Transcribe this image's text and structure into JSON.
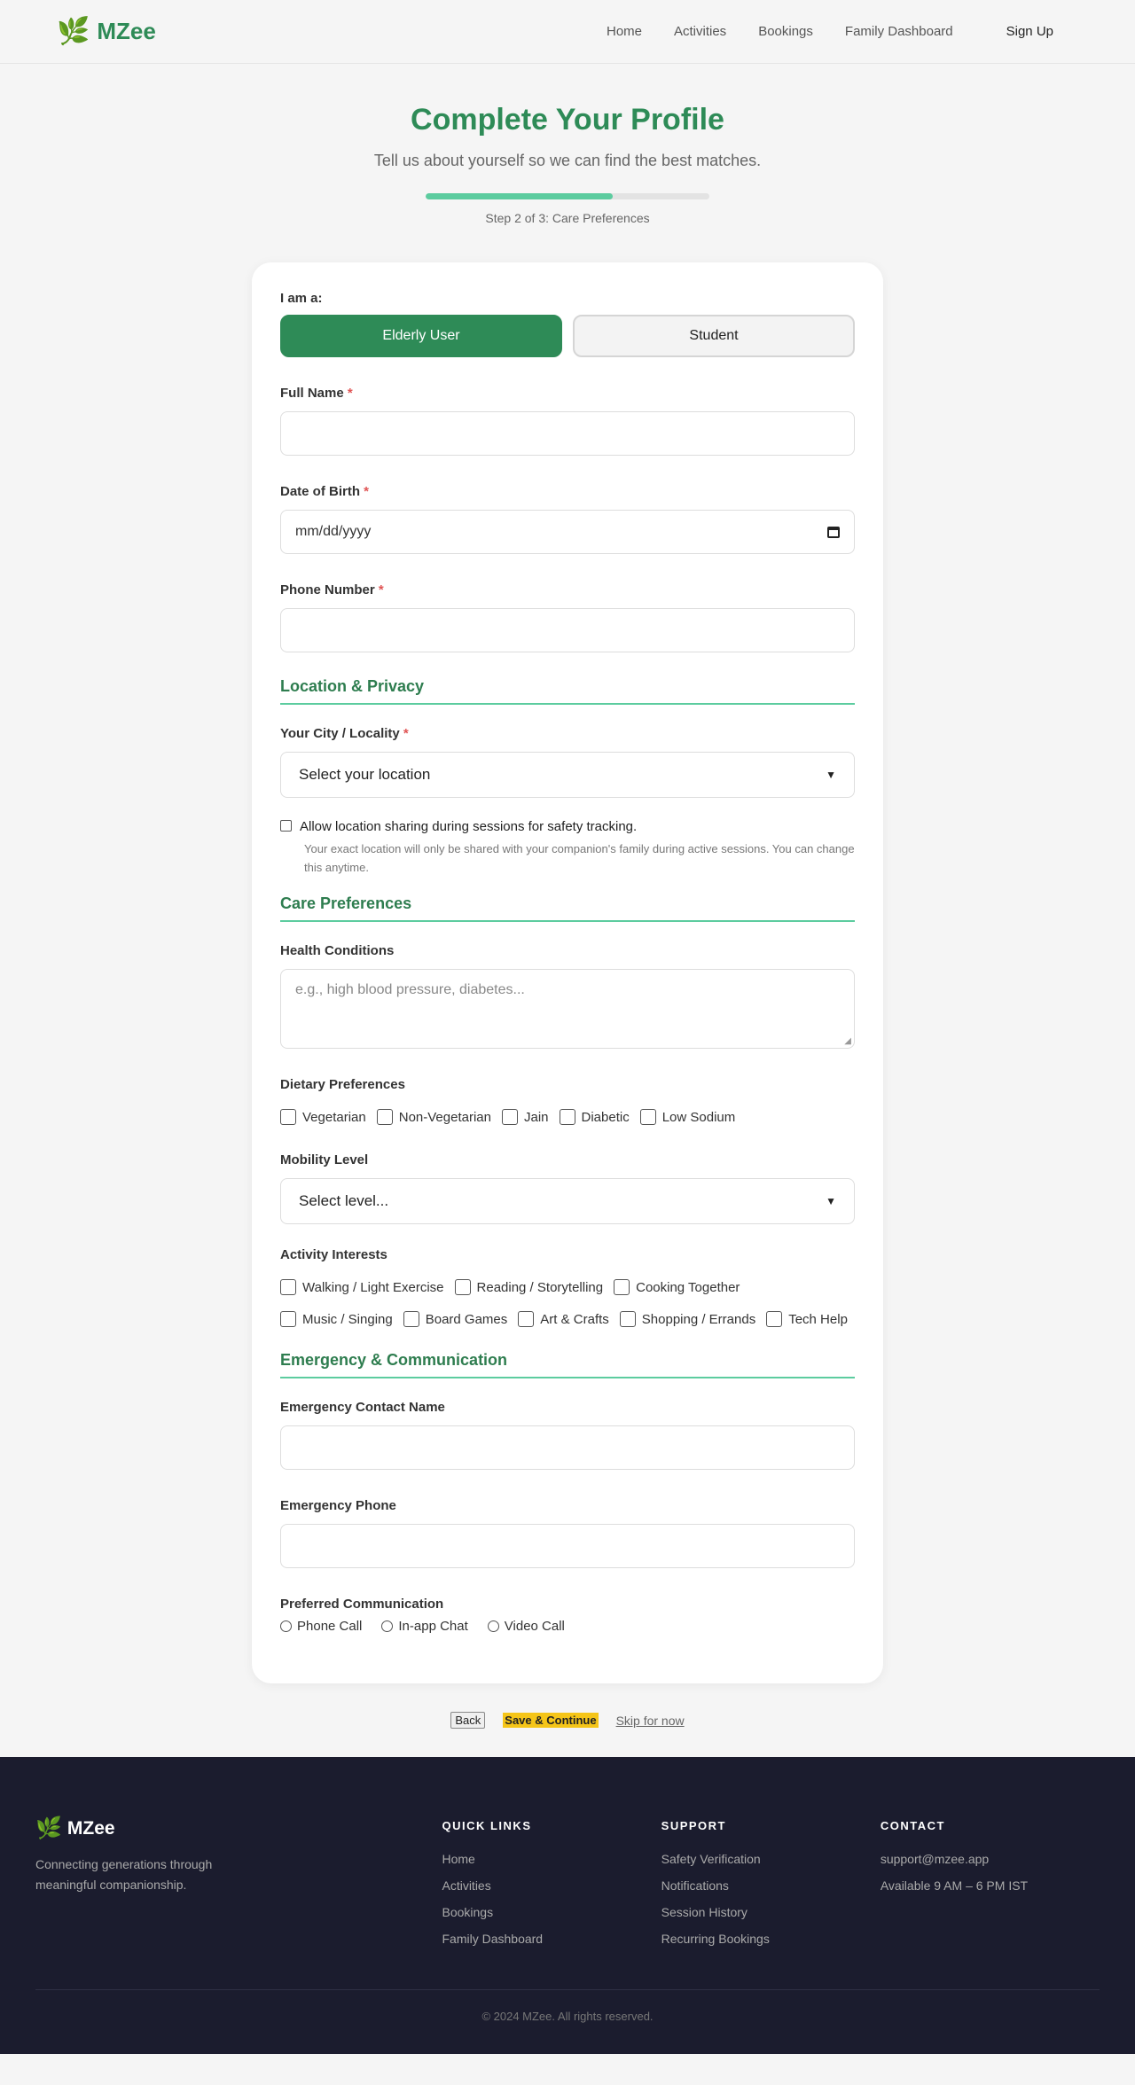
{
  "nav": {
    "brand_icon": "🌿",
    "brand": "MZee",
    "links": [
      "Home",
      "Activities",
      "Bookings",
      "Family Dashboard"
    ],
    "signup": "Sign Up"
  },
  "hero": {
    "title": "Complete Your Profile",
    "subtitle": "Tell us about yourself so we can find the best matches.",
    "progress_fraction": 0.66,
    "step_text": "Step 2 of 3: Care Preferences"
  },
  "form": {
    "role_label": "I am a:",
    "roles": [
      "Elderly User",
      "Student"
    ],
    "full_name_label": "Full Name",
    "dob_label": "Date of Birth",
    "dob_placeholder": "mm/dd/yyyy",
    "phone_label": "Phone Number",
    "required_mark": "*",
    "section_location": "Location & Privacy",
    "city_label": "Your City / Locality",
    "city_value": "Select your location",
    "location_consent": "Allow location sharing during sessions for safety tracking.",
    "location_hint": "Your exact location will only be shared with your companion's family during active sessions. You can change this anytime.",
    "section_care": "Care Preferences",
    "health_label": "Health Conditions",
    "health_placeholder": "e.g., high blood pressure, diabetes...",
    "diet_label": "Dietary Preferences",
    "diet_options": [
      "Vegetarian",
      "Non-Vegetarian",
      "Jain",
      "Diabetic",
      "Low Sodium"
    ],
    "mobility_label": "Mobility Level",
    "mobility_value": "Select level...",
    "interests_label": "Activity Interests",
    "interests": [
      "Walking / Light Exercise",
      "Reading / Storytelling",
      "Cooking Together",
      "Music / Singing",
      "Board Games",
      "Art & Crafts",
      "Shopping / Errands",
      "Tech Help"
    ],
    "section_emergency": "Emergency & Communication",
    "emergency_name_label": "Emergency Contact Name",
    "emergency_phone_label": "Emergency Phone",
    "comm_label": "Preferred Communication",
    "comm_options": [
      "Phone Call",
      "In-app Chat",
      "Video Call"
    ]
  },
  "actions": {
    "back": "Back",
    "save": "Save & Continue",
    "skip": "Skip for now"
  },
  "footer": {
    "brand_icon": "🌿",
    "brand": "MZee",
    "tagline": "Connecting generations through meaningful companionship.",
    "quick_links_title": "QUICK LINKS",
    "quick_links": [
      "Home",
      "Activities",
      "Bookings",
      "Family Dashboard"
    ],
    "support_title": "SUPPORT",
    "support_links": [
      "Safety Verification",
      "Notifications",
      "Session History",
      "Recurring Bookings"
    ],
    "contact_title": "CONTACT",
    "contact": [
      "support@mzee.app",
      "Available 9 AM – 6 PM IST"
    ],
    "copyright": "© 2024 MZee. All rights reserved."
  },
  "colors": {
    "brand_green": "#2e8b57",
    "progress": "#5ccc9f",
    "required": "#e05555",
    "save_highlight": "#f5c518",
    "footer_bg": "#1b1c2e"
  }
}
